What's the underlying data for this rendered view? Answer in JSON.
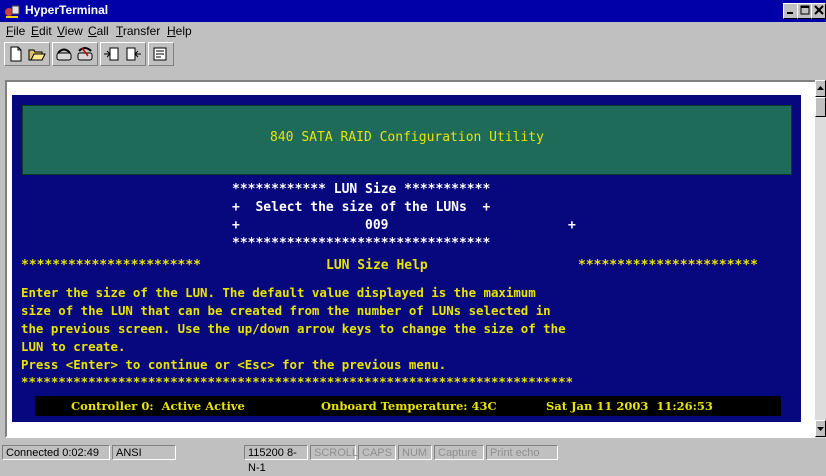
{
  "window": {
    "title": "HyperTerminal"
  },
  "menu": [
    "File",
    "Edit",
    "View",
    "Call",
    "Transfer",
    "Help"
  ],
  "toolbar": {
    "icons": [
      "new-icon",
      "open-icon",
      "connect-icon",
      "disconnect-icon",
      "send-icon",
      "receive-icon",
      "properties-icon"
    ]
  },
  "terminal": {
    "header": "840 SATA RAID Configuration Utility",
    "lun_box": {
      "line1": "************ LUN Size ***********",
      "line2": "+  Select the size of the LUNs  +",
      "line3_left": "+",
      "value": "009",
      "line3_right": "+",
      "line4": "*********************************"
    },
    "help": {
      "stars_left": "***********************",
      "title": "LUN Size Help",
      "stars_right": "***********************",
      "lines": [
        "Enter the size of the LUN. The default value displayed is the maximum",
        "size of the LUN that can be created from the number of LUNs selected in",
        "the previous screen. Use the up/down arrow keys to change the size of the",
        "LUN to create.",
        "Press <Enter> to continue or <Esc> for the previous menu.",
        "**************************************************************************"
      ]
    },
    "status": {
      "controller": "Controller 0:  Active Active",
      "temperature": "Onboard Temperature: 43C",
      "datetime": "Sat Jan 11 2003  11:26:53"
    }
  },
  "statusbar": {
    "connected": "Connected 0:02:49",
    "emulation": "ANSI",
    "port": "115200 8-N-1",
    "scroll": "SCROLL",
    "caps": "CAPS",
    "num": "NUM",
    "capture": "Capture",
    "print_echo": "Print echo"
  },
  "colors": {
    "screen_bg": "#08087e",
    "header_bg": "#1f6b5a",
    "text": "#e8e400",
    "titlebar": "#0000a8"
  }
}
